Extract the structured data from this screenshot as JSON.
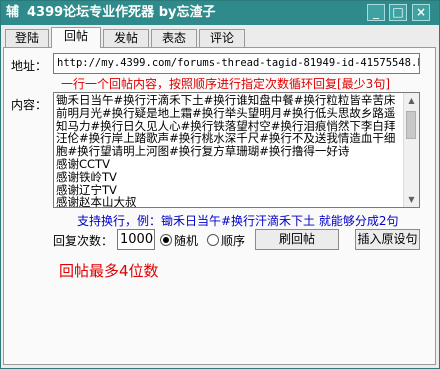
{
  "window": {
    "icon": "辅",
    "title": "4399论坛专业作死器 by忘渣子",
    "controls": {
      "minimize": "_",
      "maximize": "□",
      "close": "×"
    }
  },
  "tabs": [
    {
      "label": "登陆"
    },
    {
      "label": "回帖"
    },
    {
      "label": "发帖"
    },
    {
      "label": "表态"
    },
    {
      "label": "评论"
    }
  ],
  "active_tab": "回帖",
  "form": {
    "address_label": "地址：",
    "address_value": "http://my.4399.com/forums-thread-tagid-81949-id-41575548.html",
    "line_hint": "一行一个回帖内容，按照顺序进行指定次数循环回复[最少3句]",
    "content_label": "内容：",
    "content_value": "锄禾日当午#换行汗滴禾下土#换行谁知盘中餐#换行粒粒皆辛苦床前明月光#换行疑是地上霜#换行举头望明月#换行低头思故乡路遥知马力#换行日久见人心#换行铁落望村空#换行泪痕悄然下李白拜汪伦#换行岸上踏歌声#换行桃水深千尺#换行不及送我情造血干细胞#换行望请明上河图#换行复方草珊瑚#换行撸得一好诗\n感谢CCTV\n感谢铁岭TV\n感谢辽宁TV\n感谢赵本山大叔",
    "wrap_hint": "支持换行，例：锄禾日当午#换行汗滴禾下土 就能够分成2句",
    "count_label": "回复次数：",
    "count_value": "1000",
    "mode_random": "随机",
    "mode_sequence": "顺序",
    "mode_selected": "随机",
    "reply_button": "刷回帖",
    "insert_button": "插入原设句",
    "max_hint": "回帖最多4位数"
  },
  "scrollbar": {
    "up": "▲",
    "down": "▼"
  }
}
